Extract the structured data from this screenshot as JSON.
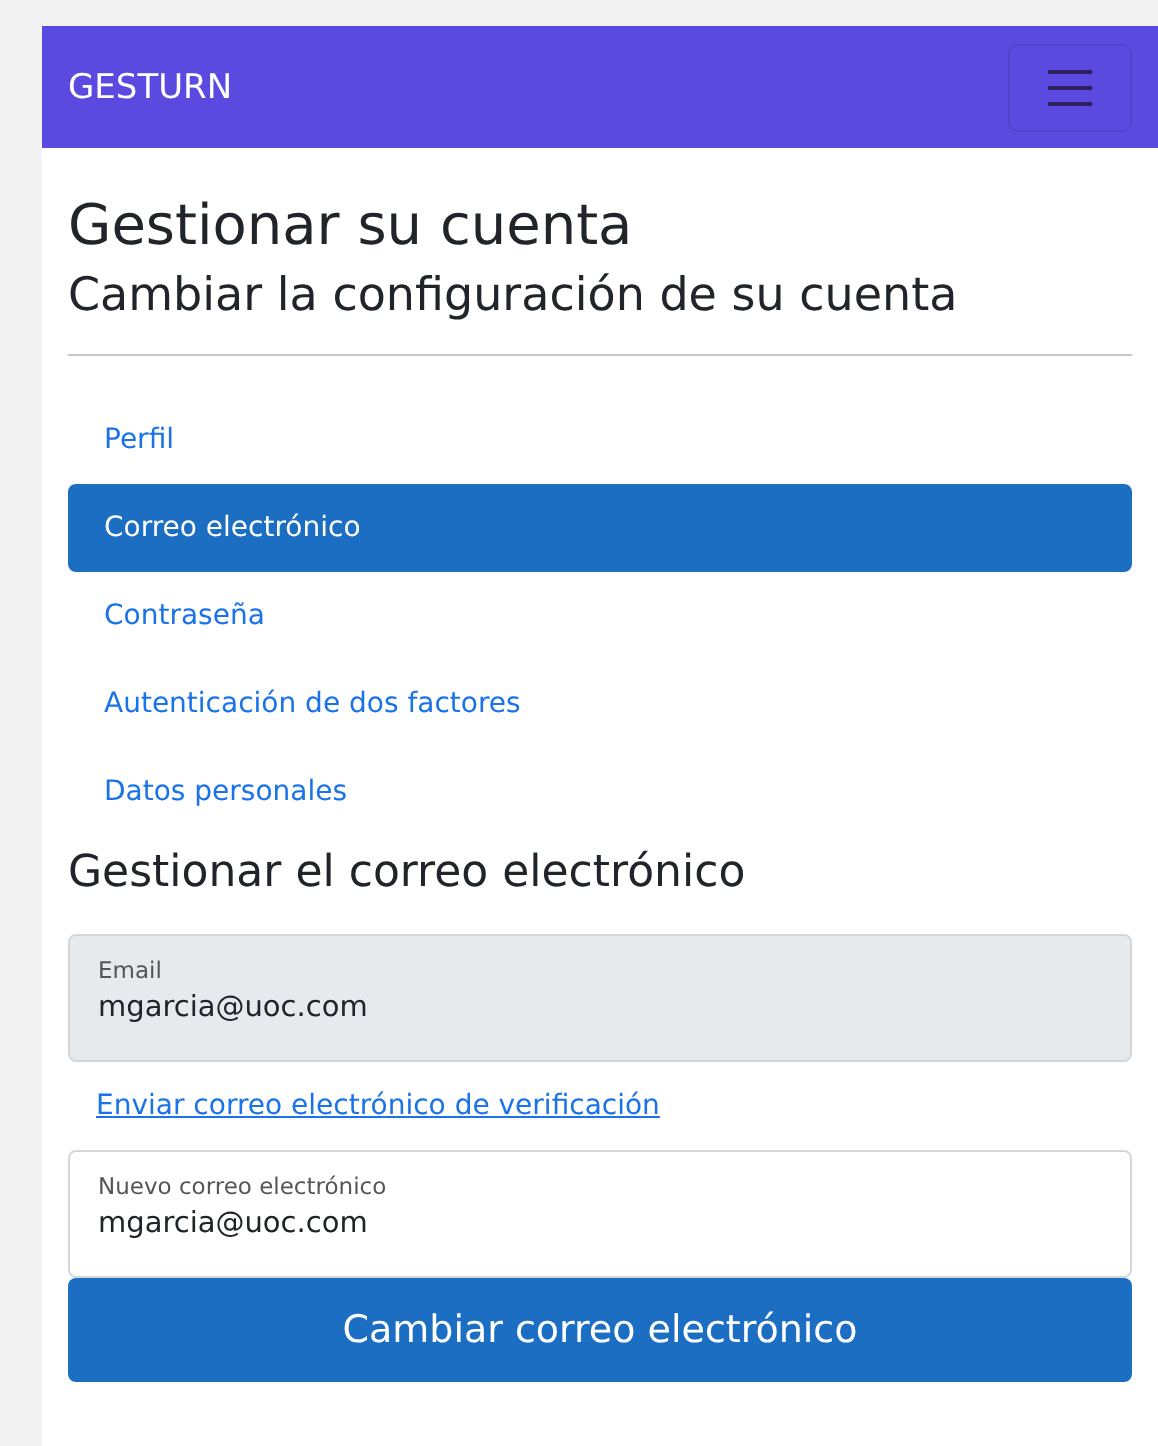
{
  "navbar": {
    "brand": "GESTURN"
  },
  "page": {
    "title": "Gestionar su cuenta",
    "subtitle": "Cambiar la configuración de su cuenta"
  },
  "nav_items": [
    {
      "label": "Perfil",
      "selected": false
    },
    {
      "label": "Correo electrónico",
      "selected": true
    },
    {
      "label": "Contraseña",
      "selected": false
    },
    {
      "label": "Autenticación de dos factores",
      "selected": false
    },
    {
      "label": "Datos personales",
      "selected": false
    }
  ],
  "section": {
    "title": "Gestionar el correo electrónico"
  },
  "email_field": {
    "label": "Email",
    "value": "mgarcia@uoc.com",
    "disabled": true
  },
  "verify_link": "Enviar correo electrónico de verificación",
  "new_email_field": {
    "label": "Nuevo correo electrónico",
    "value": "mgarcia@uoc.com",
    "disabled": false
  },
  "submit_button": "Cambiar correo electrónico"
}
